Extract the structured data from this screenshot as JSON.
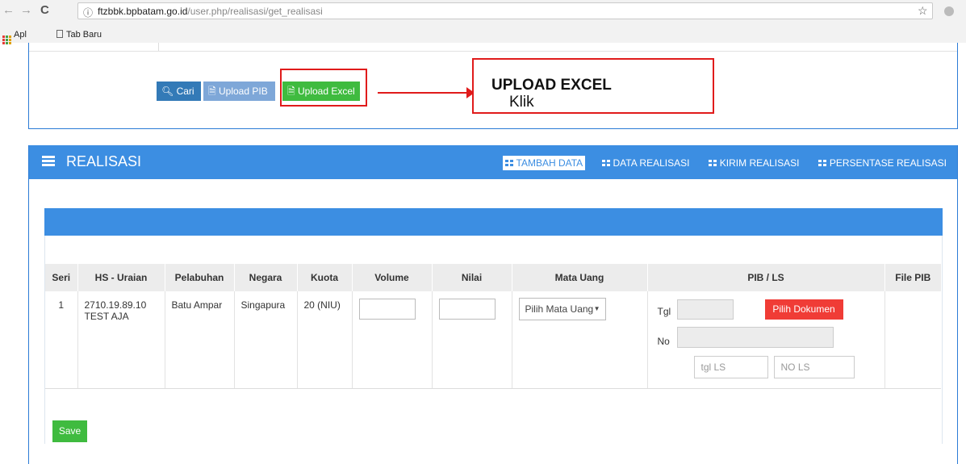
{
  "browser": {
    "url_host": "ftzbbk.bpbatam.go.id",
    "url_path": "/user.php/realisasi/get_realisasi",
    "bookmarks": [
      "Apl",
      "Tab Baru"
    ]
  },
  "search_panel": {
    "buttons": {
      "cari": "Cari",
      "upload_pib": "Upload PIB",
      "upload_excel": "Upload Excel"
    }
  },
  "callout": {
    "prefix": "Klik ",
    "emphasis": "UPLOAD EXCEL"
  },
  "realisasi": {
    "title": "REALISASI",
    "tabs": [
      "TAMBAH DATA",
      "DATA REALISASI",
      "KIRIM REALISASI",
      "PERSENTASE REALISASI"
    ],
    "active_tab": "TAMBAH DATA",
    "table": {
      "headers": [
        "Seri",
        "HS - Uraian",
        "Pelabuhan",
        "Negara",
        "Kuota",
        "Volume",
        "Nilai",
        "Mata Uang",
        "PIB / LS",
        "File PIB"
      ],
      "rows": [
        {
          "seri": "1",
          "hs_code": "2710.19.89.10",
          "uraian": "TEST AJA",
          "pelabuhan": "Batu Ampar",
          "negara": "Singapura",
          "kuota": "20 (NIU)",
          "volume": "",
          "nilai": "",
          "mata_uang": "Pilih Mata Uang"
        }
      ]
    },
    "pib": {
      "tgl_label": "Tgl",
      "no_label": "No",
      "pilih_dokumen": "Pilih Dokumen",
      "tgl_ls_placeholder": "tgl LS",
      "no_ls_placeholder": "NO LS"
    },
    "save_label": "Save"
  },
  "colors": {
    "primary": "#3c8ee2",
    "success": "#3fbb3f",
    "danger": "#f03c36",
    "highlight": "#e01b1b"
  }
}
